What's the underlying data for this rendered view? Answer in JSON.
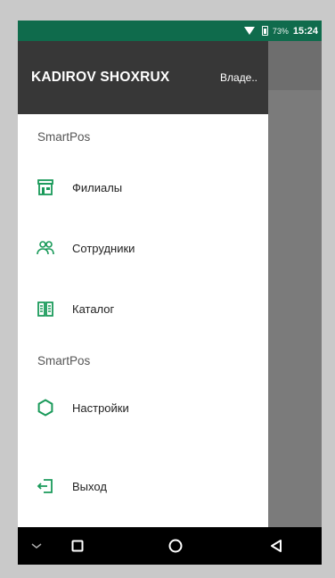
{
  "status": {
    "battery": "73%",
    "time": "15:24"
  },
  "drawer": {
    "user_name": "KADIROV SHOXRUX",
    "user_role": "Владе..",
    "section1": "SmartPos",
    "items1": [
      {
        "label": "Филиалы",
        "icon": "store-icon"
      },
      {
        "label": "Сотрудники",
        "icon": "users-icon"
      },
      {
        "label": "Каталог",
        "icon": "catalog-icon"
      }
    ],
    "section2": "SmartPos",
    "items2": [
      {
        "label": "Настройки",
        "icon": "settings-icon"
      }
    ],
    "logout": "Выход"
  },
  "colors": {
    "accent": "#1a9a5a",
    "statusbar": "#0f6b4c",
    "header": "#373737"
  }
}
